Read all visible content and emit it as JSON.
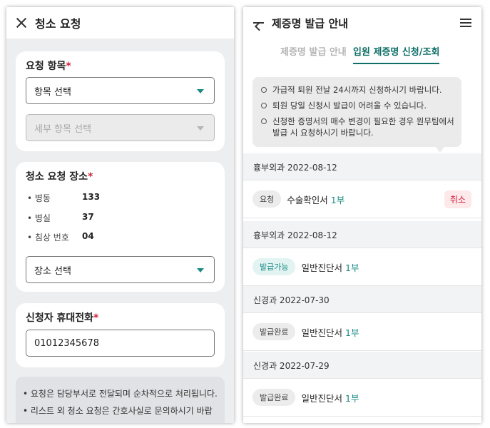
{
  "left": {
    "header": {
      "title": "청소 요청"
    },
    "request_item": {
      "title": "요청 항목",
      "required_mark": "*",
      "item_select": "항목 선택",
      "detail_select_placeholder": "세부 항목 선택"
    },
    "location": {
      "title": "청소 요청 장소",
      "required_mark": "*",
      "fields": [
        {
          "label": "• 병동",
          "value": "133"
        },
        {
          "label": "• 병실",
          "value": "37"
        },
        {
          "label": "• 침상 번호",
          "value": "04"
        }
      ],
      "place_select": "장소 선택"
    },
    "phone": {
      "title": "신청자 휴대전화",
      "required_mark": "*",
      "value": "01012345678"
    },
    "notice": [
      "• 요청은 담당부서로 전달되며 순차적으로 처리됩니다.",
      "• 리스트 외 청소 요청은 간호사실로 문의하시기 바랍"
    ]
  },
  "right": {
    "header": {
      "title": "제증명 발급 안내"
    },
    "tabs": [
      {
        "label": "제증명 발급 안내",
        "active": false
      },
      {
        "label": "입원 제증명 신청/조회",
        "active": true
      }
    ],
    "notices": [
      "가급적 퇴원 전날 24시까지 신청하시기 바랍니다.",
      "퇴원 당일 신청시 발급이 어려울 수 있습니다.",
      "신청한 증명서의 매수 변경이 필요한 경우 원무팀에서 발급 시 요청하시기 바랍니다."
    ],
    "groups": [
      {
        "header": "흉부외과 2022-08-12",
        "status": "요청",
        "doc": "수술확인서",
        "count": "1부",
        "action": "취소"
      },
      {
        "header": "흉부외과 2022-08-12",
        "status": "발급가능",
        "doc": "일반진단서",
        "count": "1부"
      },
      {
        "header": "신경과 2022-07-30",
        "status": "발급완료",
        "doc": "일반진단서",
        "count": "1부"
      },
      {
        "header": "신경과 2022-07-29",
        "status": "발급완료",
        "doc": "일반진단서",
        "count": "1부"
      }
    ]
  },
  "colors": {
    "accent": "#1a8a82",
    "required": "#d0213a",
    "cancel_bg": "#fde8ea"
  }
}
